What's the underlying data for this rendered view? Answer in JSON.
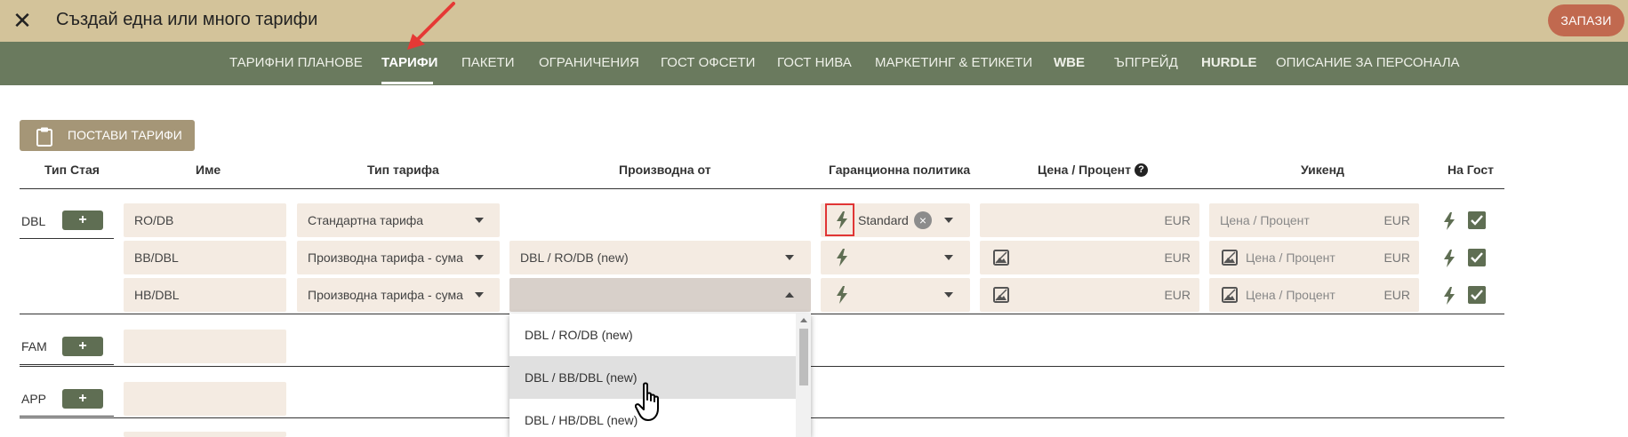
{
  "header": {
    "title": "Създай една или много тарифи",
    "close_icon": "close-icon",
    "save_label": "ЗАПАЗИ",
    "save_color": "#c1694f"
  },
  "tabs": [
    {
      "label": "ТАРИФНИ ПЛАНОВЕ",
      "active": false
    },
    {
      "label": "ТАРИФИ",
      "active": true
    },
    {
      "label": "ПАКЕТИ",
      "active": false
    },
    {
      "label": "ОГРАНИЧЕНИЯ",
      "active": false
    },
    {
      "label": "ГОСТ ОФСЕТИ",
      "active": false
    },
    {
      "label": "ГОСТ НИВА",
      "active": false
    },
    {
      "label": "МАРКЕТИНГ & ЕТИКЕТИ",
      "active": false
    },
    {
      "label": "WBE",
      "active": false
    },
    {
      "label": "ЪПГРЕЙД",
      "active": false
    },
    {
      "label": "HURDLE",
      "active": false
    },
    {
      "label": "ОПИСАНИЕ ЗА ПЕРСОНАЛА",
      "active": false
    }
  ],
  "toolbar": {
    "place_rates_label": "ПОСТАВИ ТАРИФИ",
    "place_rates_icon": "clipboard-icon"
  },
  "columns": {
    "room_type": "Тип Стая",
    "name": "Име",
    "rate_type": "Тип тарифа",
    "derived_from": "Производна от",
    "guarantee": "Гаранционна политика",
    "price": "Цена / Процент",
    "weekend": "Уикенд",
    "on_guest": "На Гост"
  },
  "rooms": [
    {
      "code": "DBL",
      "add_label": "+"
    },
    {
      "code": "FAM",
      "add_label": "+"
    },
    {
      "code": "APP",
      "add_label": "+"
    }
  ],
  "rows": [
    {
      "name": "RO/DB",
      "rate_type": "Стандартна тарифа",
      "derived_from": "",
      "guarantee": "Standard",
      "currency": "EUR",
      "weekend_placeholder": "Цена / Процент",
      "weekend_currency": "EUR",
      "on_guest": true
    },
    {
      "name": "BB/DBL",
      "rate_type": "Производна тарифа - сума",
      "derived_from": "DBL / RO/DB (new)",
      "guarantee": "",
      "currency": "EUR",
      "weekend_placeholder": "Цена / Процент",
      "weekend_currency": "EUR",
      "on_guest": true
    },
    {
      "name": "HB/DBL",
      "rate_type": "Производна тарифа - сума",
      "derived_from": "",
      "guarantee": "",
      "currency": "EUR",
      "weekend_placeholder": "Цена / Процент",
      "weekend_currency": "EUR",
      "on_guest": true
    }
  ],
  "dropdown": {
    "options": [
      "DBL / RO/DB (new)",
      "DBL / BB/DBL (new)",
      "DBL / HB/DBL (new)"
    ],
    "hovered_index": 1
  },
  "help_glyph": "?",
  "clear_glyph": "×"
}
